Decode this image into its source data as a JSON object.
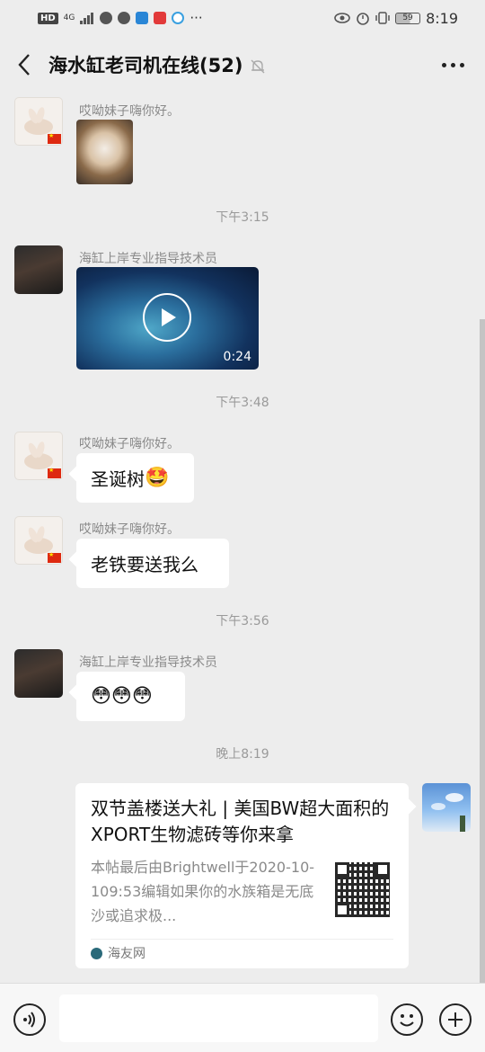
{
  "status_bar": {
    "left_badge": "HD",
    "network": "4G",
    "battery": "59",
    "time": "8:19"
  },
  "header": {
    "title": "海水缸老司机在线(52)"
  },
  "messages": [
    {
      "sender": "哎呦妹子嗨你好。",
      "type": "image"
    },
    {
      "type": "time",
      "text": "下午3:15"
    },
    {
      "sender": "海缸上岸专业指导技术员",
      "type": "video",
      "duration": "0:24"
    },
    {
      "type": "time",
      "text": "下午3:48"
    },
    {
      "sender": "哎呦妹子嗨你好。",
      "type": "text",
      "text": "圣诞树",
      "emoji": "🤩"
    },
    {
      "sender": "哎呦妹子嗨你好。",
      "type": "text",
      "text": "老铁要送我么"
    },
    {
      "type": "time",
      "text": "下午3:56"
    },
    {
      "sender": "海缸上岸专业指导技术员",
      "type": "emoji",
      "text": "😳😳😳"
    },
    {
      "type": "time",
      "text": "晚上8:19"
    }
  ],
  "link_card": {
    "title": "双节盖楼送大礼 | 美国BW超大面积的XPORT生物滤砖等你来拿",
    "description": "本帖最后由Brightwell于2020-10-109:53编辑如果你的水族箱是无底沙或追求极...",
    "source": "海友网"
  },
  "icons": {
    "back": "chevron-left-icon",
    "mute": "bell-muted-icon",
    "more": "more-dots-icon",
    "voice": "voice-icon",
    "emoji": "emoji-icon",
    "plus": "plus-icon"
  }
}
